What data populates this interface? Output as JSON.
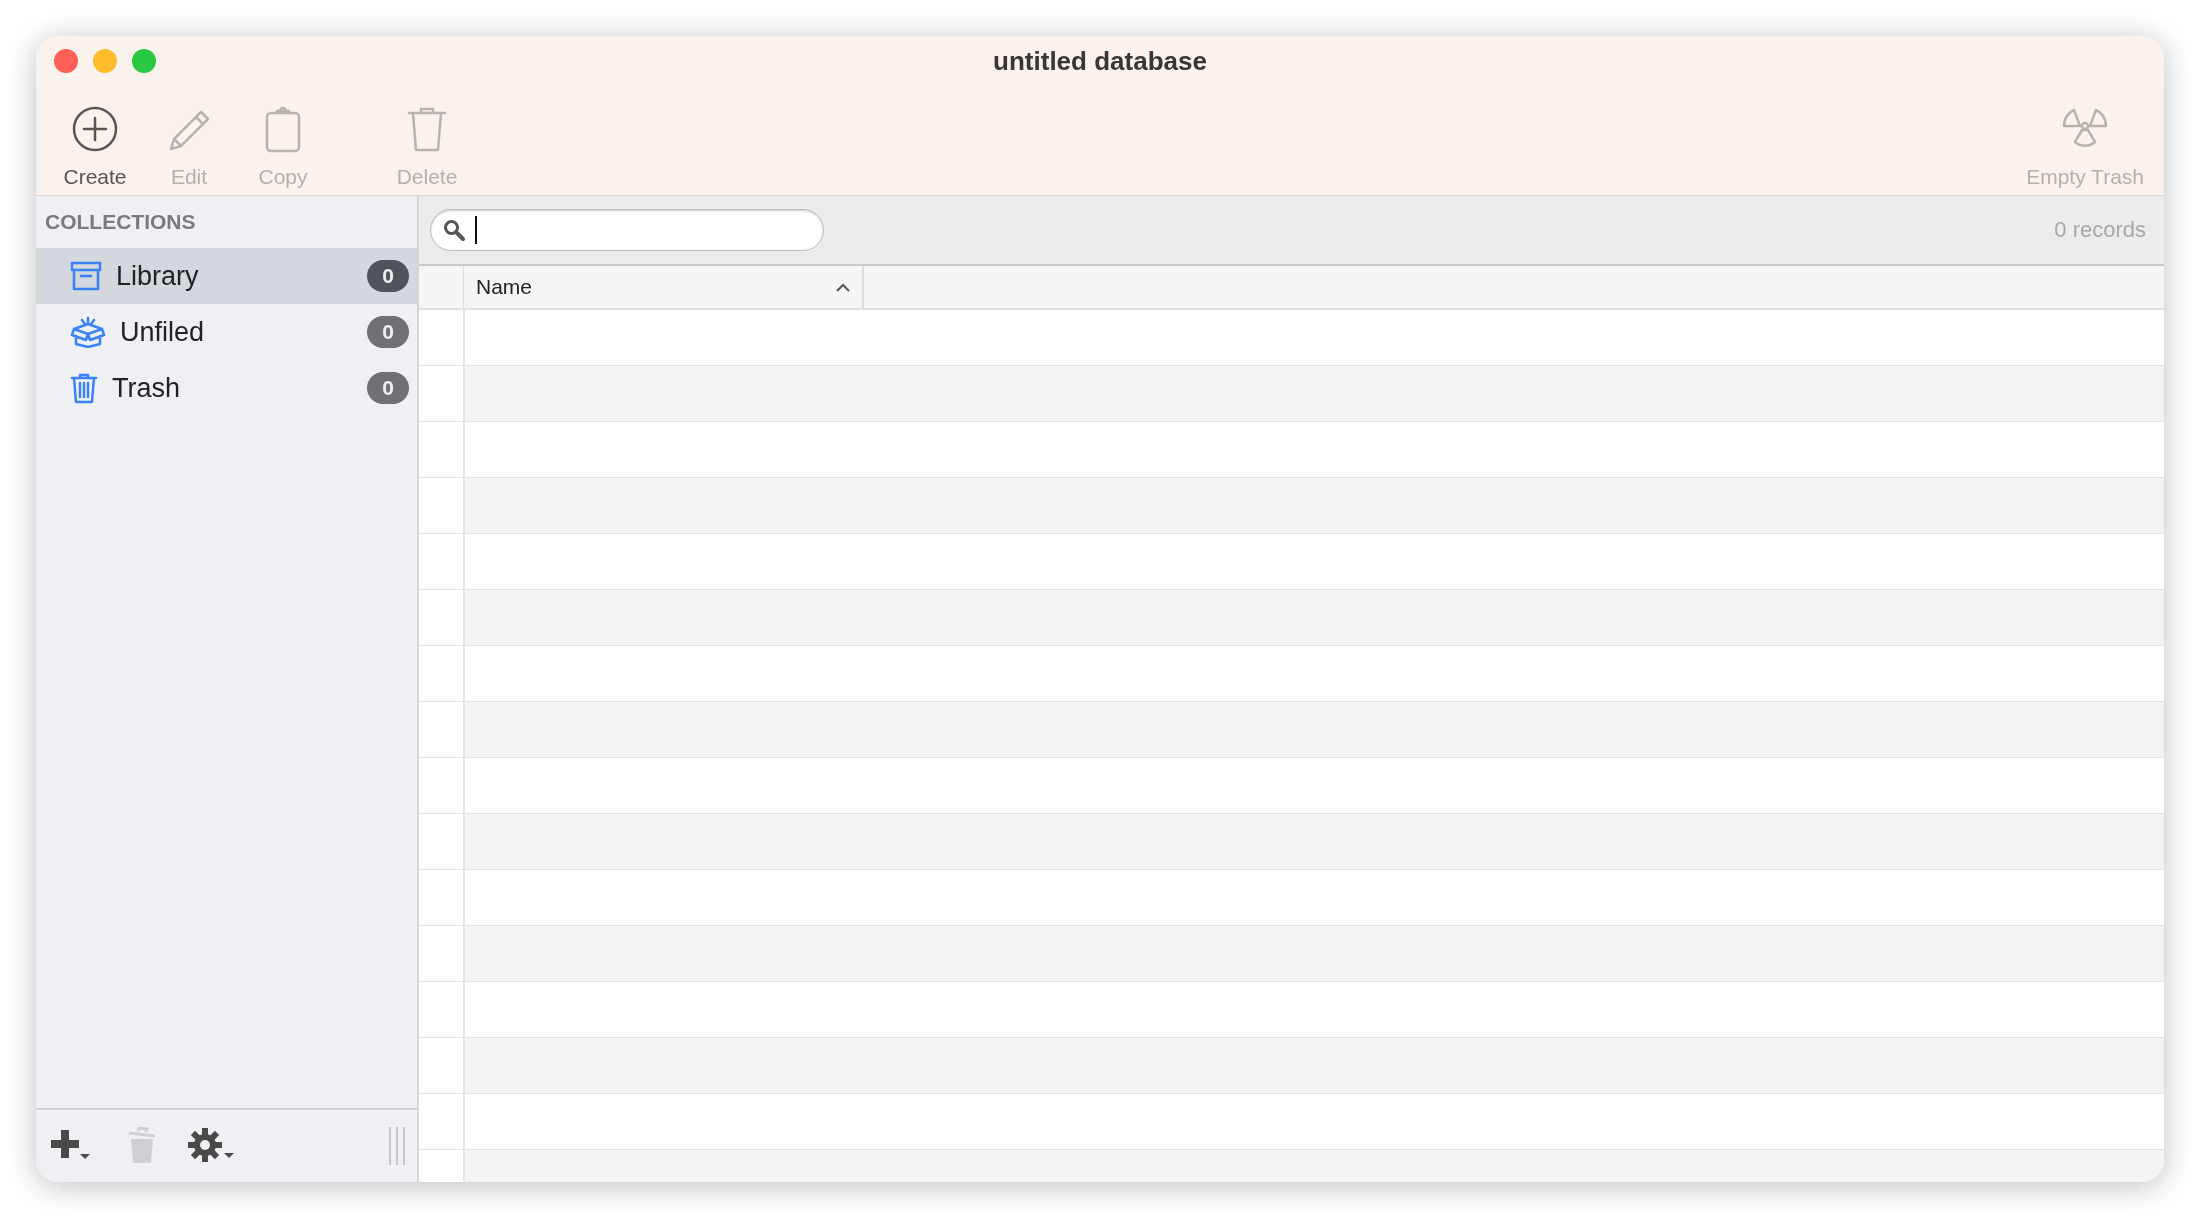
{
  "window": {
    "title": "untitled database"
  },
  "toolbar": [
    {
      "kind": "create",
      "label": "Create",
      "disabled": false
    },
    {
      "kind": "edit",
      "label": "Edit",
      "disabled": true
    },
    {
      "kind": "copy",
      "label": "Copy",
      "disabled": true
    },
    {
      "kind": "delete",
      "label": "Delete",
      "disabled": true
    },
    {
      "kind": "empty_trash",
      "label": "Empty Trash",
      "disabled": true
    }
  ],
  "sidebar": {
    "heading": "COLLECTIONS",
    "items": [
      {
        "kind": "library",
        "label": "Library",
        "count": "0",
        "selected": true
      },
      {
        "kind": "unfiled",
        "label": "Unfiled",
        "count": "0",
        "selected": false
      },
      {
        "kind": "trash",
        "label": "Trash",
        "count": "0",
        "selected": false
      }
    ],
    "bottom_buttons": [
      {
        "kind": "add",
        "disabled": false
      },
      {
        "kind": "trash",
        "disabled": true
      },
      {
        "kind": "gear",
        "disabled": false
      }
    ]
  },
  "record_count": "0 records",
  "table": {
    "columns": [
      {
        "label": "Name",
        "sort_ascending": true
      }
    ]
  }
}
